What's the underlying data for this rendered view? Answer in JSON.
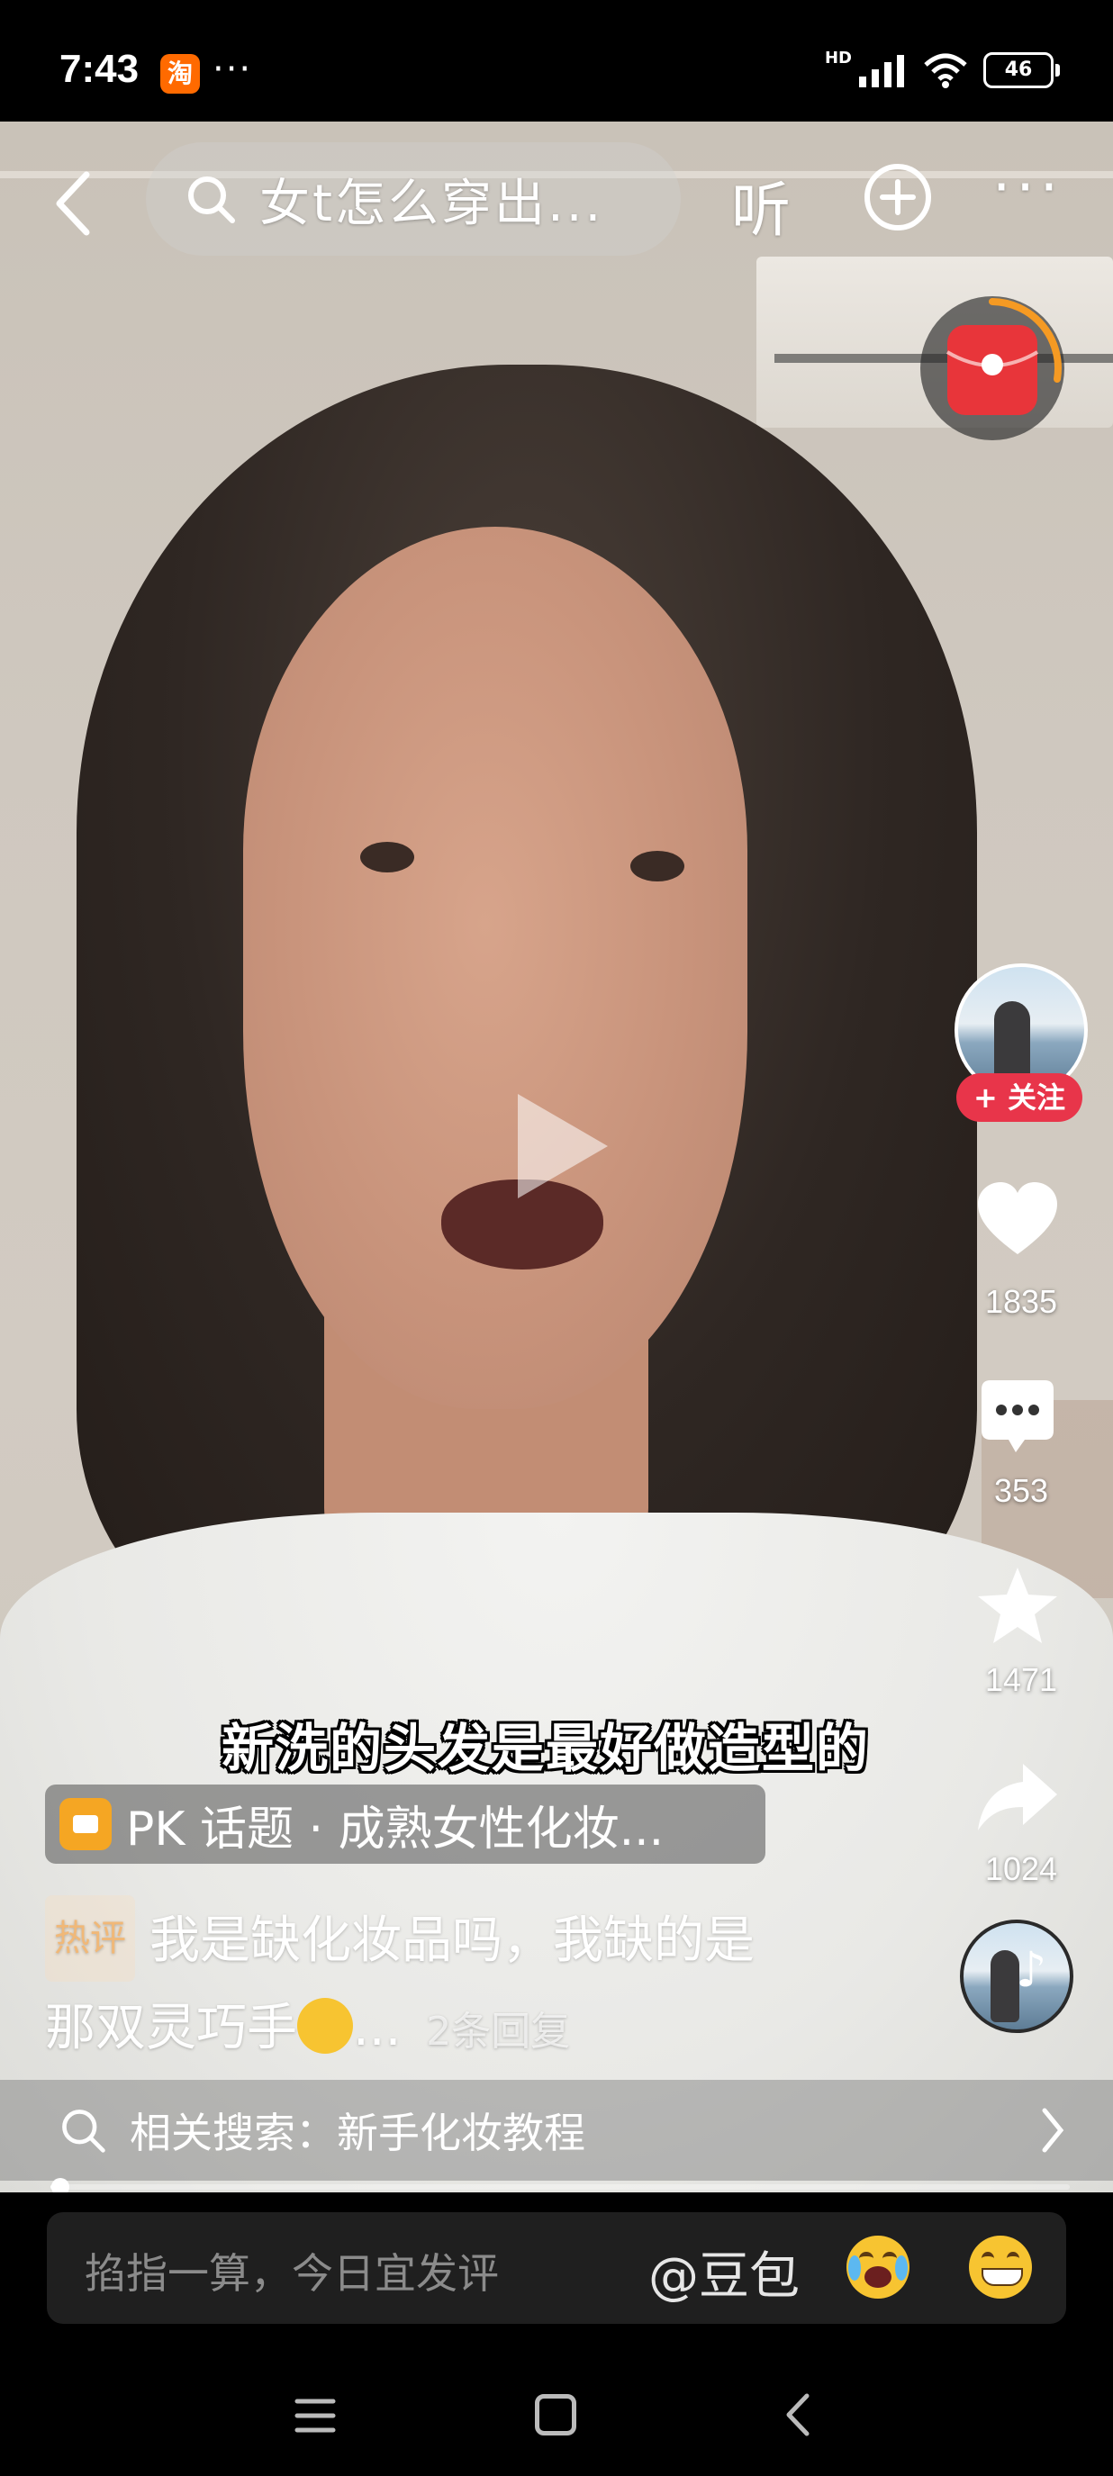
{
  "status_bar": {
    "time": "7:43",
    "app_badge": "淘",
    "dots": "···",
    "network": "HD",
    "battery": "46"
  },
  "top_bar": {
    "search_query": "女t怎么穿出...",
    "listen_label": "听"
  },
  "side_rail": {
    "follow_label": "+ 关注",
    "like_count": "1835",
    "comment_count": "353",
    "favorite_count": "1471",
    "share_count": "1024"
  },
  "video": {
    "subtitle": "新洗的头发是最好做造型的"
  },
  "pk_topic": {
    "label": "PK 话题 · 成熟女性化妆..."
  },
  "hot_comment": {
    "tag": "热评",
    "text_line1": "我是缺化妆品吗，我缺的是",
    "text_line2": "那双灵巧手",
    "ellipsis": "...",
    "reply_count": "2条回复"
  },
  "related_search": {
    "label": "相关搜索：新手化妆教程"
  },
  "progress": {
    "fraction": 0.01
  },
  "comment_bar": {
    "placeholder": "掐指一算，今日宜发评",
    "doubao_label": "@豆包"
  },
  "icons": {
    "back": "chevron-left-icon",
    "search": "search-icon",
    "add": "plus-circle-icon",
    "more": "more-dots-icon",
    "like": "heart-icon",
    "comment": "comment-bubble-icon",
    "favorite": "star-icon",
    "share": "share-arrow-icon"
  },
  "colors": {
    "follow_red": "#e8354a",
    "pk_orange": "#f5a623",
    "redpacket": "#e8353a"
  }
}
